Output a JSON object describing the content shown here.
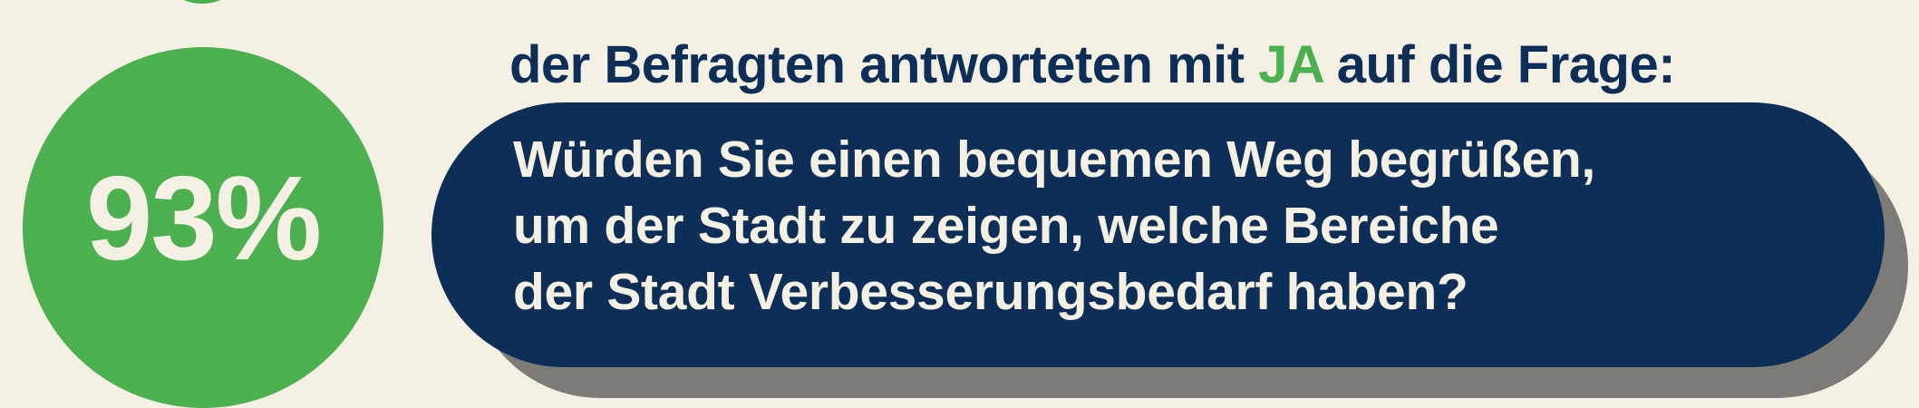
{
  "stat": {
    "percentage": "93%"
  },
  "intro": {
    "before": "der Befragten antworteten mit ",
    "highlight": "JA",
    "after": " auf die Frage:"
  },
  "question": {
    "lines": [
      "Würden Sie einen bequemen Weg begrüßen,",
      "um der Stadt zu zeigen, welche Bereiche",
      "der Stadt Verbesserungsbedarf haben?"
    ]
  },
  "colors": {
    "background": "#f5f0e4",
    "accent_green": "#4caf50",
    "navy": "#0d2f57",
    "shadow_gray": "#7c7b76",
    "text_light": "#f5f0e4"
  }
}
